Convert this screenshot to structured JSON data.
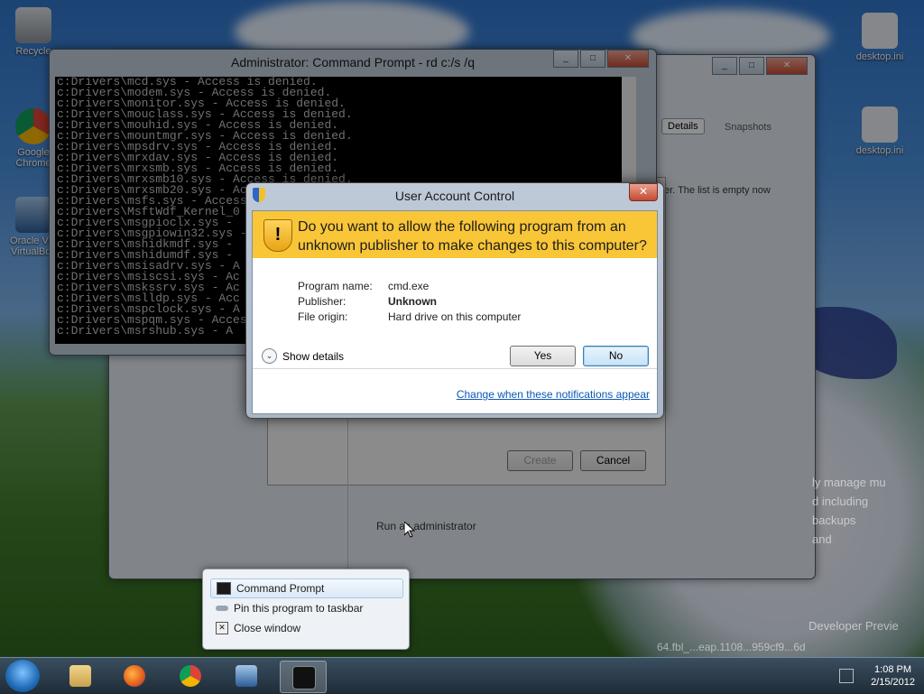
{
  "desktop": {
    "icons_left": [
      {
        "label": "Recycle",
        "name": "recycle-bin-icon"
      },
      {
        "label": "Google Chrome",
        "name": "chrome-desktop-icon"
      },
      {
        "label": "Oracle VM VirtualBox",
        "name": "virtualbox-desktop-icon"
      }
    ],
    "icons_right": [
      {
        "label": "desktop.ini"
      },
      {
        "label": "desktop.ini"
      }
    ]
  },
  "cmd_window": {
    "title": "Administrator: Command Prompt - rd  c:/s /q",
    "lines": [
      "c:Drivers\\mcd.sys - Access is denied.",
      "c:Drivers\\modem.sys - Access is denied.",
      "c:Drivers\\monitor.sys - Access is denied.",
      "c:Drivers\\mouclass.sys - Access is denied.",
      "c:Drivers\\mouhid.sys - Access is denied.",
      "c:Drivers\\mountmgr.sys - Access is denied.",
      "c:Drivers\\mpsdrv.sys - Access is denied.",
      "c:Drivers\\mrxdav.sys - Access is denied.",
      "c:Drivers\\mrxsmb.sys - Access is denied.",
      "c:Drivers\\mrxsmb10.sys - Access is denied.",
      "c:Drivers\\mrxsmb20.sys - Access is denied.",
      "c:Drivers\\msfs.sys - Access is denied.",
      "c:Drivers\\MsftWdf_Kernel_0",
      "c:Drivers\\msgpioclx.sys -",
      "c:Drivers\\msgpiowin32.sys -",
      "c:Drivers\\mshidkmdf.sys -",
      "c:Drivers\\mshidumdf.sys -",
      "c:Drivers\\msisadrv.sys - A",
      "c:Drivers\\msiscsi.sys - Ac",
      "c:Drivers\\mskssrv.sys - Ac",
      "c:Drivers\\mslldp.sys - Acc",
      "c:Drivers\\mspclock.sys - A",
      "c:Drivers\\mspqm.sys - Acces",
      "c:Drivers\\msrshub.sys - A"
    ]
  },
  "vbox_window": {
    "details_tab": "Details",
    "snapshots_tab": "Snapshots",
    "empty_text": "er. The list is empty now",
    "create_button": "Create",
    "cancel_button": "Cancel",
    "run_as": "Run as administrator"
  },
  "uac": {
    "title": "User Account Control",
    "question": "Do you want to allow the following program from an unknown publisher to make changes to this computer?",
    "fields": [
      {
        "label": "Program name:",
        "value": "cmd.exe",
        "bold": false
      },
      {
        "label": "Publisher:",
        "value": "Unknown",
        "bold": true
      },
      {
        "label": "File origin:",
        "value": "Hard drive on this computer",
        "bold": false
      }
    ],
    "show_details": "Show details",
    "yes_button": "Yes",
    "no_button": "No",
    "change_link": "Change when these notifications appear"
  },
  "jumplist": {
    "items": [
      "Command Prompt",
      "Pin this program to taskbar",
      "Close window"
    ]
  },
  "right_text": {
    "lines": [
      "ly manage mu",
      "d including ",
      "backups",
      "and",
      "Developer Previe",
      "64.fbl_...eap.1108...959cf9...6d"
    ]
  },
  "taskbar": {
    "time": "1:08 PM",
    "date": "2/15/2012"
  }
}
